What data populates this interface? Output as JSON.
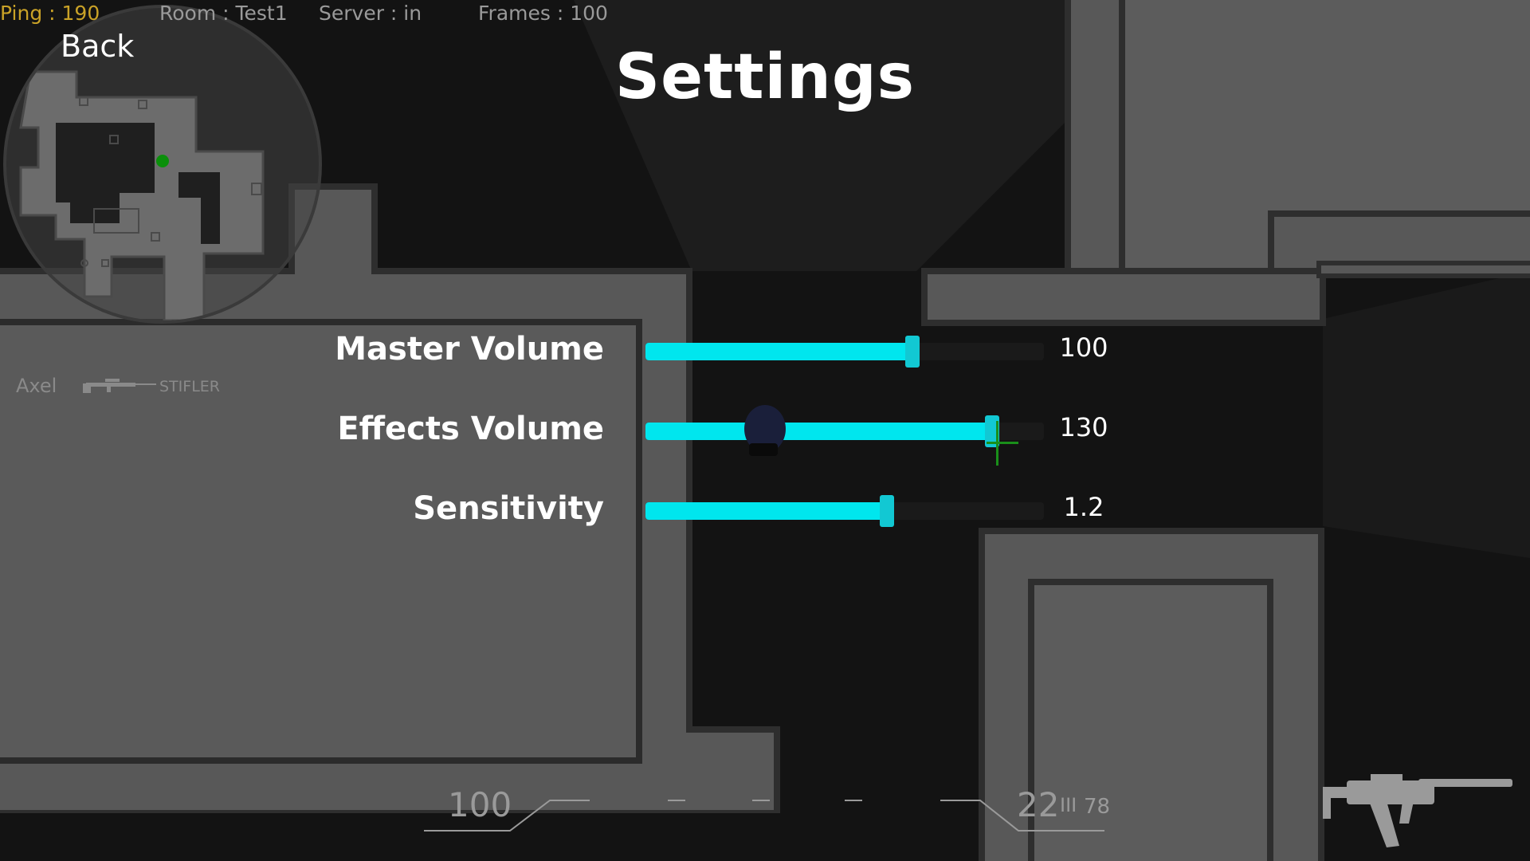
{
  "hud": {
    "ping": "Ping : 190",
    "room": "Room : Test1",
    "server": "Server : in",
    "frames": "Frames : 100",
    "ping_color": "#c9a227",
    "stat_color": "#9a9a9a"
  },
  "back_label": "Back",
  "title": "Settings",
  "kill_feed": {
    "player": "Axel",
    "weapon_icon": "sniper-rifle-icon",
    "victim": "STIFLER"
  },
  "settings": [
    {
      "label": "Master Volume",
      "value": "100",
      "fill": 0.67
    },
    {
      "label": "Effects Volume",
      "value": "130",
      "fill": 0.87
    },
    {
      "label": "Sensitivity",
      "value": "1.2",
      "fill": 0.605
    }
  ],
  "bottom_hud": {
    "health": "100",
    "ammo": "22",
    "ammo_separator": "III",
    "reserve": "78",
    "weapon_icon": "smg-icon"
  },
  "colors": {
    "accent": "#00e6ee",
    "handle": "#12c8d3",
    "minimap_player": "#0a8f0a",
    "crosshair": "#1a8f1a",
    "wall": "#585858",
    "floor": "#131313"
  }
}
